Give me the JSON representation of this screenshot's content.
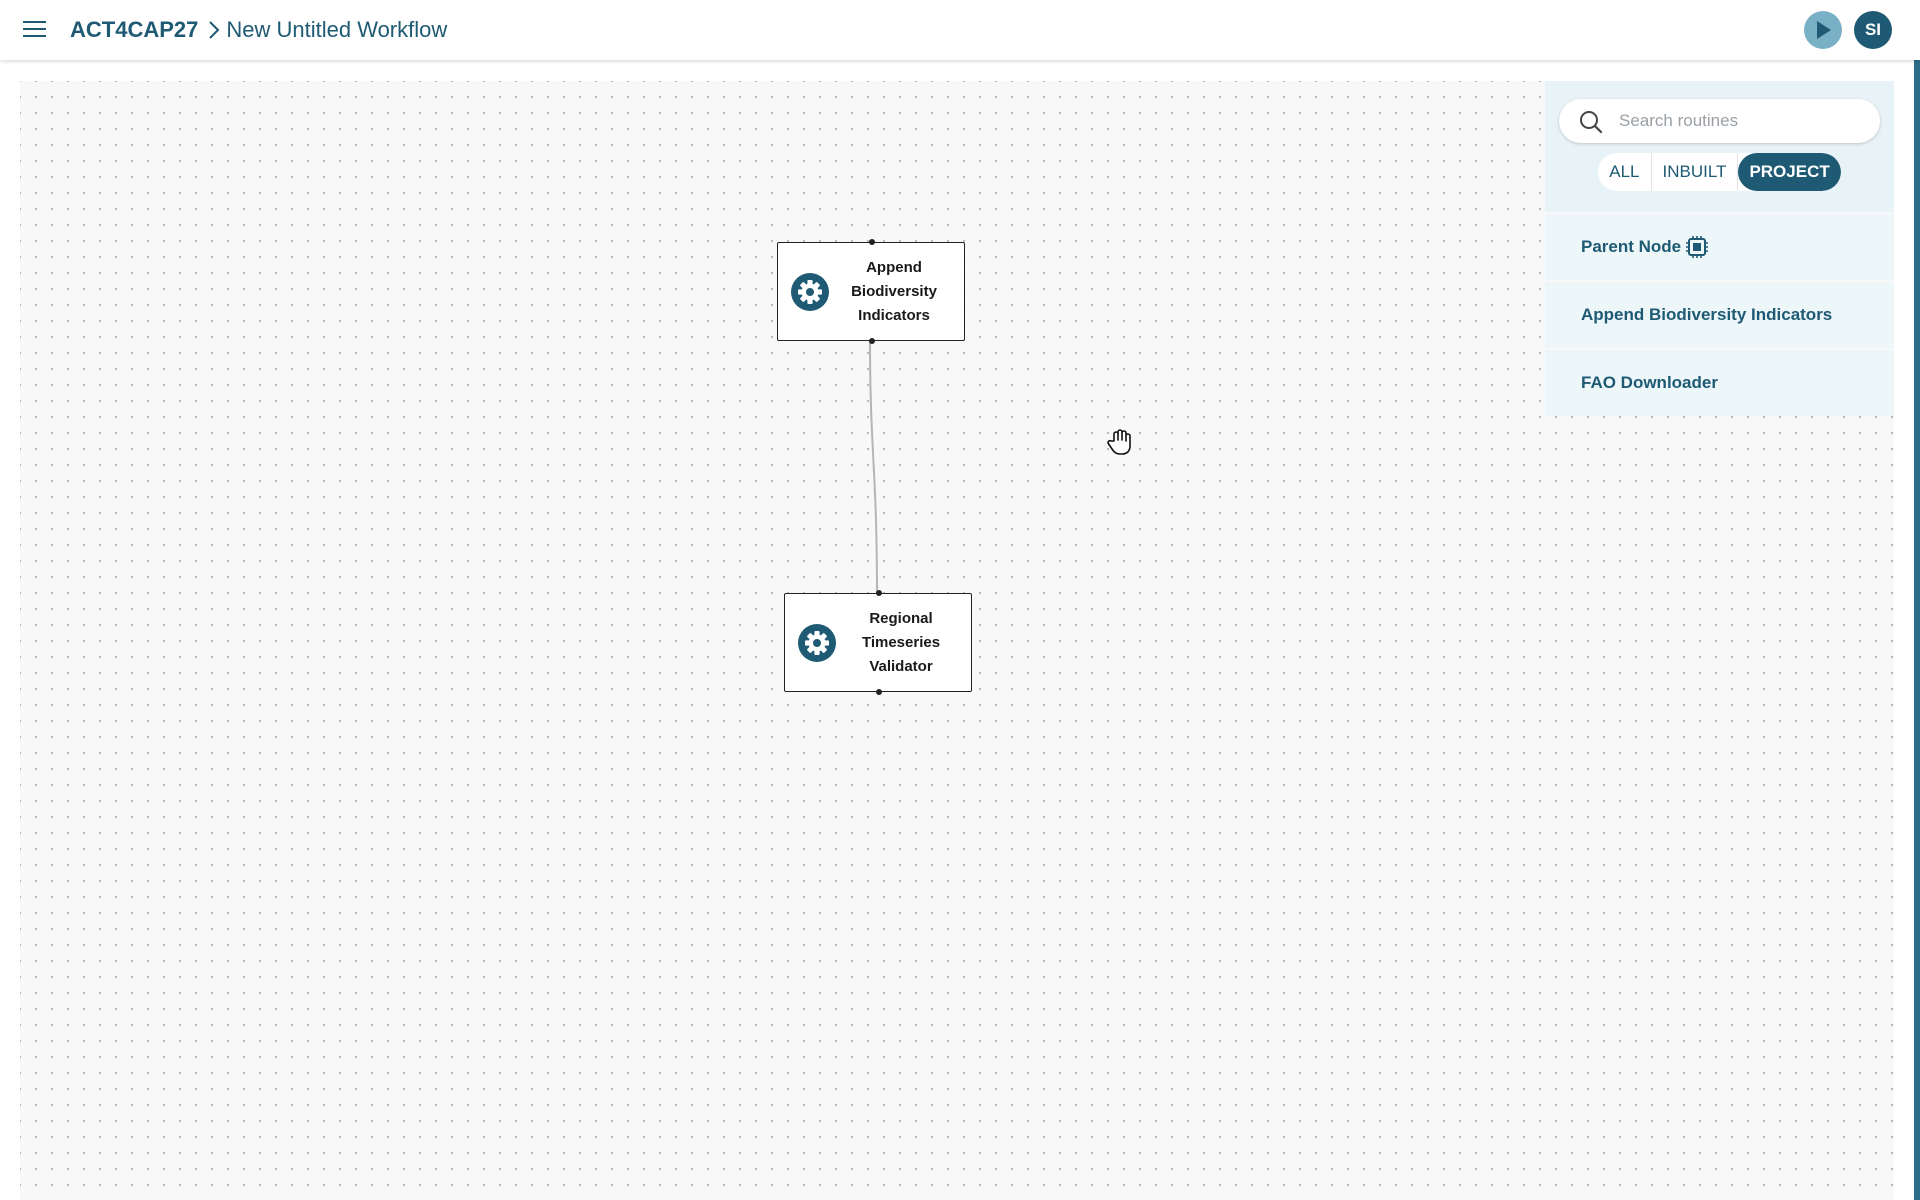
{
  "header": {
    "project": "ACT4CAP27",
    "workflow": "New Untitled Workflow",
    "user_initials": "SI"
  },
  "canvas": {
    "nodes": [
      {
        "title_lines": [
          "Append",
          "Biodiversity",
          "Indicators"
        ]
      },
      {
        "title_lines": [
          "Regional",
          "Timeseries",
          "Validator"
        ]
      }
    ]
  },
  "panel": {
    "search_placeholder": "Search routines",
    "filters": [
      "ALL",
      "INBUILT",
      "PROJECT"
    ],
    "active_filter": "PROJECT",
    "routines": [
      "Parent Node",
      "Append Biodiversity Indicators",
      "FAO Downloader"
    ]
  },
  "colors": {
    "accent": "#1e5a73",
    "run_button": "#7ab0c6",
    "panel_bg": "#e8f3f7"
  },
  "icons": {
    "menu": "hamburger-icon",
    "breadcrumb_separator": "chevron-right-icon",
    "run": "play-icon",
    "node": "gear-icon",
    "search": "search-icon",
    "parent_node": "chip-icon",
    "cursor": "hand-grab-icon"
  }
}
